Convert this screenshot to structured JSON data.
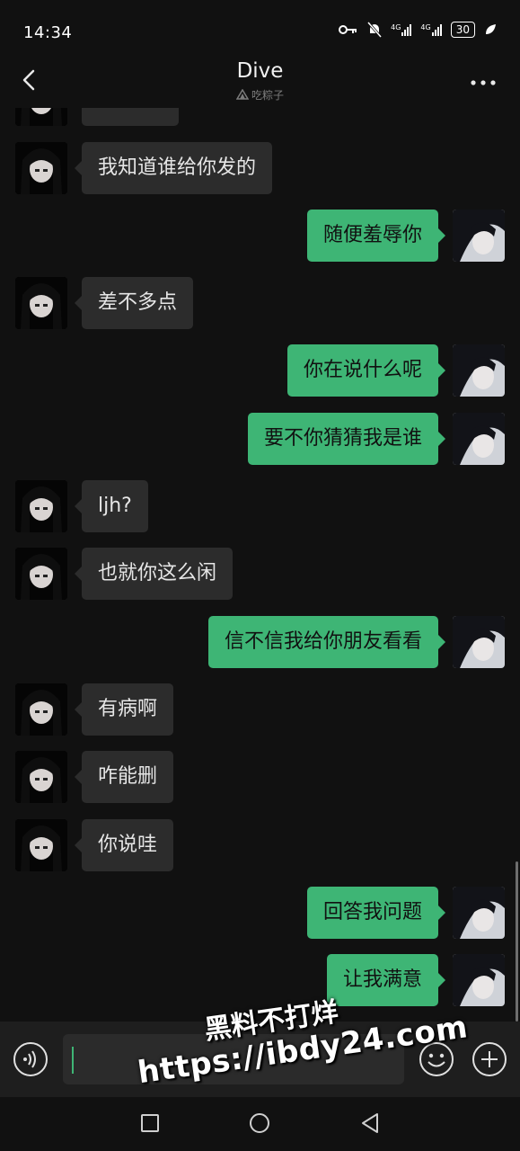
{
  "status": {
    "time": "14:34",
    "network_1": "4G",
    "network_2": "4G",
    "battery": "30",
    "icons": [
      "key-icon",
      "mute-bell-icon",
      "signal-icon",
      "signal-icon",
      "battery-icon",
      "leaf-icon"
    ]
  },
  "header": {
    "title": "Dive",
    "subtitle": "吃粽子",
    "back_icon": "chevron-left-icon",
    "more_icon": "more-dots-icon"
  },
  "messages": [
    {
      "side": "left",
      "text": ""
    },
    {
      "side": "left",
      "text": "我知道谁给你发的"
    },
    {
      "side": "right",
      "text": "随便羞辱你"
    },
    {
      "side": "left",
      "text": "差不多点"
    },
    {
      "side": "right",
      "text": "你在说什么呢"
    },
    {
      "side": "right",
      "text": "要不你猜猜我是谁"
    },
    {
      "side": "left",
      "text": "ljh?"
    },
    {
      "side": "left",
      "text": "也就你这么闲"
    },
    {
      "side": "right",
      "text": "信不信我给你朋友看看"
    },
    {
      "side": "left",
      "text": "有病啊"
    },
    {
      "side": "left",
      "text": "咋能删"
    },
    {
      "side": "left",
      "text": "你说哇"
    },
    {
      "side": "right",
      "text": "回答我问题"
    },
    {
      "side": "right",
      "text": "让我满意"
    }
  ],
  "input_bar": {
    "input_value": "",
    "icons": [
      "voice-icon",
      "emoji-icon",
      "plus-icon"
    ]
  },
  "watermark": {
    "line1": "黑料不打烊",
    "line2": "https://ibdy24.com"
  },
  "nav_bar": {
    "icons": [
      "recents-square-icon",
      "home-circle-icon",
      "back-triangle-icon"
    ]
  },
  "colors": {
    "background": "#111111",
    "left_bubble": "#2c2c2c",
    "right_bubble": "#3eb575",
    "accent": "#3eb575"
  }
}
